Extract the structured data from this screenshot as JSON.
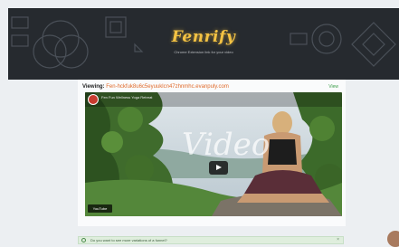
{
  "header": {
    "logo": "Fenrify",
    "tagline": "Chrome Extension link for your video"
  },
  "main": {
    "viewing_label": "Viewing:",
    "viewing_url": "Fen-hckfuk8u6c5eyuuklcn47zhnmhc.evanpuly.com",
    "view_button": "View",
    "video": {
      "title": "Fen Fun Wellness Yoga Retreat",
      "watermark": "Video",
      "badge": "YouTube"
    }
  },
  "alert": {
    "text": "Do you want to see more variations of a funnel?",
    "close": "×"
  },
  "icons": [
    "yoga-video-thumbnail",
    "play-icon",
    "info-icon",
    "close-icon",
    "user-avatar"
  ]
}
